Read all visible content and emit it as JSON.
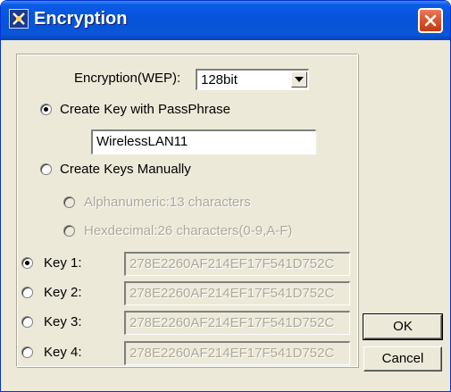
{
  "window": {
    "title": "Encryption",
    "icon": "encryption-app-icon",
    "close_icon": "close-icon"
  },
  "encryption": {
    "label": "Encryption(WEP):",
    "selected": "128bit"
  },
  "passphrase": {
    "option_label": "Create Key with PassPhrase",
    "selected": true,
    "value": "WirelessLAN11"
  },
  "manual": {
    "option_label": "Create Keys Manually",
    "selected": false,
    "alphanumeric_label": "Alphanumeric:13 characters",
    "hexdecimal_label": "Hexdecimal:26 characters(0-9,A-F)"
  },
  "keys": [
    {
      "label": "Key 1:",
      "value": "278E2260AF214EF17F541D752C",
      "selected": true
    },
    {
      "label": "Key 2:",
      "value": "278E2260AF214EF17F541D752C",
      "selected": false
    },
    {
      "label": "Key 3:",
      "value": "278E2260AF214EF17F541D752C",
      "selected": false
    },
    {
      "label": "Key 4:",
      "value": "278E2260AF214EF17F541D752C",
      "selected": false
    }
  ],
  "buttons": {
    "ok": "OK",
    "cancel": "Cancel"
  },
  "colors": {
    "titlebar": "#0553d8",
    "dialog_bg": "#ece9d8",
    "close_button": "#d9532c",
    "disabled_text": "#aca899"
  }
}
